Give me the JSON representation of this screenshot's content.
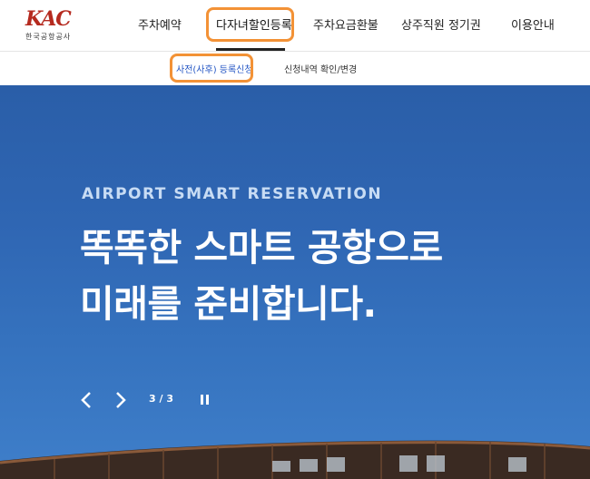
{
  "logo": {
    "mark": "KAC",
    "subtitle": "한국공항공사"
  },
  "nav": {
    "items": [
      {
        "label": "주차예약"
      },
      {
        "label": "다자녀할인등록"
      },
      {
        "label": "주차요금환불"
      },
      {
        "label": "상주직원 정기권"
      },
      {
        "label": "이용안내"
      }
    ]
  },
  "subnav": {
    "items": [
      {
        "label": "사전(사후) 등록신청"
      },
      {
        "label": "신청내역 확인/변경"
      }
    ]
  },
  "hero": {
    "eyebrow": "AIRPORT SMART RESERVATION",
    "title_line1": "똑똑한 스마트 공항으로",
    "title_line2": "미래를 준비합니다.",
    "counter": "3 / 3"
  },
  "colors": {
    "brand": "#b52a1f",
    "highlight": "#f39236",
    "active_sub": "#2456c4",
    "hero_bg": "#2f66b3"
  }
}
